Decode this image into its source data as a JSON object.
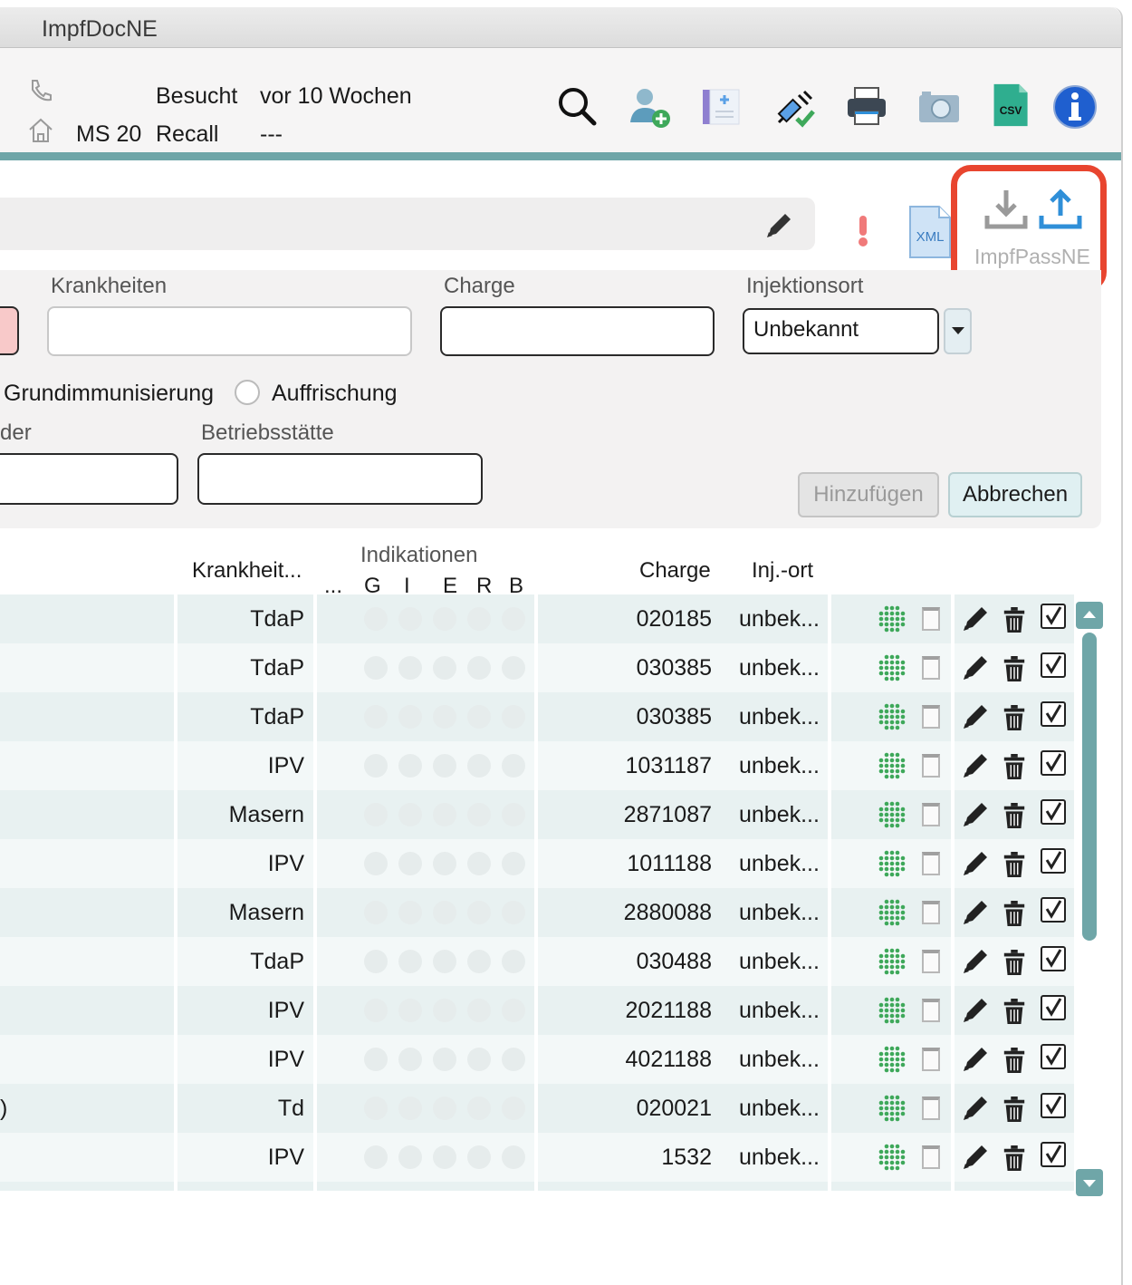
{
  "window": {
    "title": "ImpfDocNE"
  },
  "header": {
    "ms_label": "MS 20",
    "visited_label": "Besucht",
    "visited_value": "vor 10 Wochen",
    "recall_label": "Recall",
    "recall_value": "---"
  },
  "toolbar": {
    "icons": [
      "search-icon",
      "add-patient-icon",
      "new-record-icon",
      "vaccination-check-icon",
      "print-icon",
      "camera-icon",
      "csv-icon",
      "info-icon"
    ],
    "csv_text": "CSV",
    "xml_text": "XML",
    "impfpass_label": "ImpfPassNE"
  },
  "form": {
    "krankheiten_label": "Krankheiten",
    "charge_label": "Charge",
    "injektionsort_label": "Injektionsort",
    "injektionsort_value": "Unbekannt",
    "grundimmunisierung_label": "Grundimmunisierung",
    "auffrischung_label": "Auffrischung",
    "partial_label": "der",
    "betriebsstaette_label": "Betriebsstätte",
    "add_button": "Hinzufügen",
    "cancel_button": "Abbrechen"
  },
  "table": {
    "headers": {
      "krankheiten": "Krankheit...",
      "indikationen": "Indikationen",
      "ind_ellipsis": "...",
      "ind_g": "G",
      "ind_i": "I",
      "ind_e": "E",
      "ind_r": "R",
      "ind_b": "B",
      "charge": "Charge",
      "injort": "Inj.-ort"
    },
    "rows": [
      {
        "name": "",
        "krankheit": "TdaP",
        "charge": "020185",
        "injort": "unbek..."
      },
      {
        "name": "",
        "krankheit": "TdaP",
        "charge": "030385",
        "injort": "unbek..."
      },
      {
        "name": "",
        "krankheit": "TdaP",
        "charge": "030385",
        "injort": "unbek..."
      },
      {
        "name": "",
        "krankheit": "IPV",
        "charge": "1031187",
        "injort": "unbek..."
      },
      {
        "name": "",
        "krankheit": "Masern",
        "charge": "2871087",
        "injort": "unbek..."
      },
      {
        "name": "",
        "krankheit": "IPV",
        "charge": "1011188",
        "injort": "unbek..."
      },
      {
        "name": "",
        "krankheit": "Masern",
        "charge": "2880088",
        "injort": "unbek..."
      },
      {
        "name": "",
        "krankheit": "TdaP",
        "charge": "030488",
        "injort": "unbek..."
      },
      {
        "name": "",
        "krankheit": "IPV",
        "charge": "2021188",
        "injort": "unbek..."
      },
      {
        "name": "",
        "krankheit": "IPV",
        "charge": "4021188",
        "injort": "unbek..."
      },
      {
        "name": ")",
        "krankheit": "Td",
        "charge": "020021",
        "injort": "unbek..."
      },
      {
        "name": "",
        "krankheit": "IPV",
        "charge": "1532",
        "injort": "unbek..."
      }
    ]
  },
  "colors": {
    "accent_teal": "#6fa6a8",
    "highlight_red": "#e8452f",
    "virus_green": "#3ea85a",
    "blue_icon": "#2f8fd8"
  }
}
